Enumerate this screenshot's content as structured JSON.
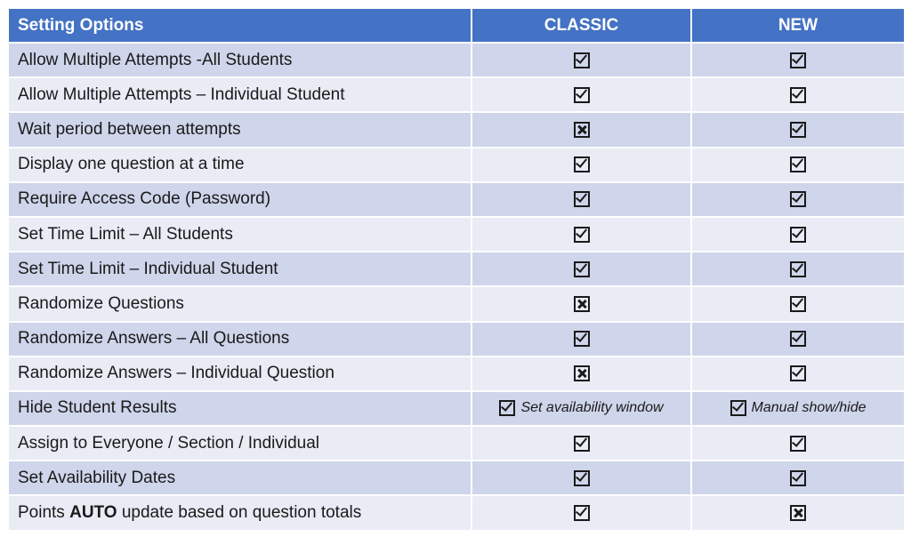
{
  "header": {
    "col1": "Setting Options",
    "col2": "CLASSIC",
    "col3": "NEW"
  },
  "rows": [
    {
      "label": "Allow Multiple Attempts -All Students",
      "classic": "check",
      "new": "check"
    },
    {
      "label": "Allow Multiple Attempts – Individual Student",
      "classic": "check",
      "new": "check"
    },
    {
      "label": "Wait period between attempts",
      "classic": "cross",
      "new": "check"
    },
    {
      "label": "Display one question at a time",
      "classic": "check",
      "new": "check"
    },
    {
      "label": "Require Access Code (Password)",
      "classic": "check",
      "new": "check"
    },
    {
      "label": "Set Time Limit – All Students",
      "classic": "check",
      "new": "check"
    },
    {
      "label": "Set Time Limit – Individual Student",
      "classic": "check",
      "new": "check"
    },
    {
      "label": "Randomize Questions",
      "classic": "cross",
      "new": "check"
    },
    {
      "label": "Randomize Answers – All Questions",
      "classic": "check",
      "new": "check"
    },
    {
      "label": "Randomize Answers – Individual Question",
      "classic": "cross",
      "new": "check"
    },
    {
      "label": "Hide Student Results",
      "classic": "check",
      "classic_note": "Set availability window",
      "new": "check",
      "new_note": "Manual show/hide"
    },
    {
      "label": "Assign to Everyone / Section / Individual",
      "classic": "check",
      "new": "check"
    },
    {
      "label": "Set Availability Dates",
      "classic": "check",
      "new": "check"
    },
    {
      "label_pre": "Points ",
      "label_bold": "AUTO",
      "label_post": " update based on question totals",
      "classic": "check",
      "new": "cross"
    }
  ],
  "colors": {
    "header": "#4472c4",
    "row_odd": "#cfd5ea",
    "row_even": "#e9ebf5"
  }
}
